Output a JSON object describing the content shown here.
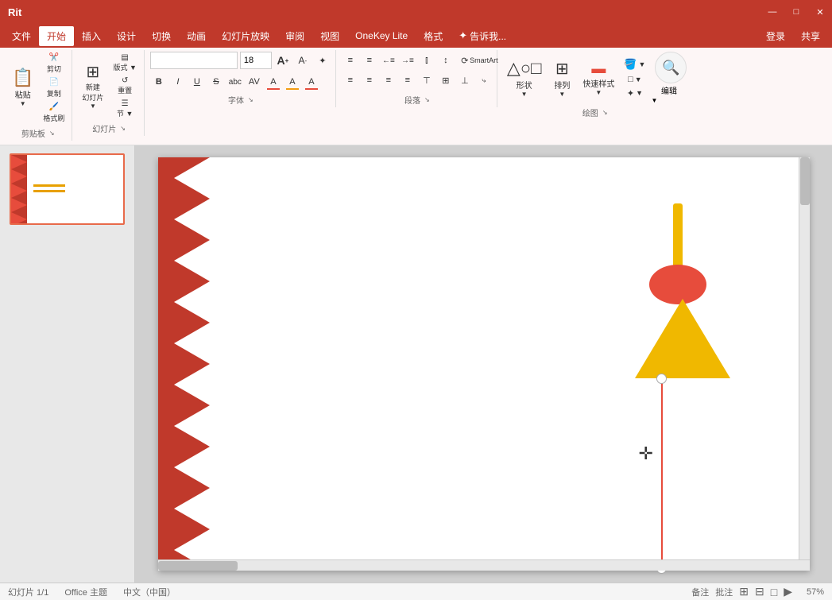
{
  "titlebar": {
    "title": "Rit",
    "minimize": "—",
    "maximize": "□",
    "close": "✕"
  },
  "menubar": {
    "items": [
      {
        "label": "文件",
        "active": false
      },
      {
        "label": "开始",
        "active": true
      },
      {
        "label": "插入",
        "active": false
      },
      {
        "label": "设计",
        "active": false
      },
      {
        "label": "切换",
        "active": false
      },
      {
        "label": "动画",
        "active": false
      },
      {
        "label": "幻灯片放映",
        "active": false
      },
      {
        "label": "审阅",
        "active": false
      },
      {
        "label": "视图",
        "active": false
      },
      {
        "label": "OneKey Lite",
        "active": false
      },
      {
        "label": "格式",
        "active": false
      },
      {
        "label": "✦ 告诉我...",
        "active": false
      },
      {
        "label": "登录",
        "active": false
      },
      {
        "label": "共享",
        "active": false
      }
    ]
  },
  "ribbon": {
    "clipboard_group": {
      "label": "剪贴板",
      "paste_label": "粘贴",
      "cut_label": "剪切",
      "copy_label": "复制",
      "format_label": "格式刷"
    },
    "slides_group": {
      "label": "幻灯片",
      "new_slide_label": "新建\n幻灯片",
      "layout_label": "版式",
      "reset_label": "重置",
      "section_label": "节"
    },
    "font_group": {
      "label": "字体",
      "font_name": "",
      "font_size": "18",
      "bold": "B",
      "italic": "I",
      "underline": "U",
      "strikethrough": "S",
      "shadow": "ab c",
      "font_color": "A",
      "char_spacing": "AV",
      "font_size_up": "A",
      "font_size_down": "A",
      "clear_format": "✦",
      "font_color_label": "A",
      "text_highlight": "A"
    },
    "paragraph_group": {
      "label": "段落",
      "bullets": "≡",
      "numbering": "≡",
      "decrease_indent": "←",
      "increase_indent": "→",
      "line_spacing": "↕",
      "columns": "⫾",
      "align_left": "≡",
      "align_center": "≡",
      "align_right": "≡",
      "justify": "≡",
      "align_top": "⊤",
      "align_middle": "⊥",
      "text_direction": "A",
      "smart_art": "SmartArt"
    },
    "drawing_group": {
      "label": "绘图",
      "shapes_label": "形状",
      "arrange_label": "排列",
      "quick_styles_label": "快速样式",
      "fill_label": "填充",
      "edit_label": "编辑"
    }
  },
  "section_labels": {
    "clipboard": "剪贴板",
    "clipboard_expand": "↘",
    "slides": "幻灯片",
    "slides_expand": "↘",
    "font": "字体",
    "font_expand": "↘",
    "paragraph": "段落",
    "paragraph_expand": "↘",
    "drawing": "绘图",
    "drawing_expand": "↘"
  },
  "slide": {
    "number": 1,
    "total": 1
  },
  "statusbar": {
    "slide_info": "幻灯片 1/1",
    "theme": "Office 主题",
    "language": "中文（中国）",
    "notes": "备注",
    "comments": "批注",
    "view_normal": "⊞",
    "view_slide_sorter": "⊟",
    "view_reading": "□",
    "view_slideshow": "▶",
    "zoom": "57%"
  }
}
